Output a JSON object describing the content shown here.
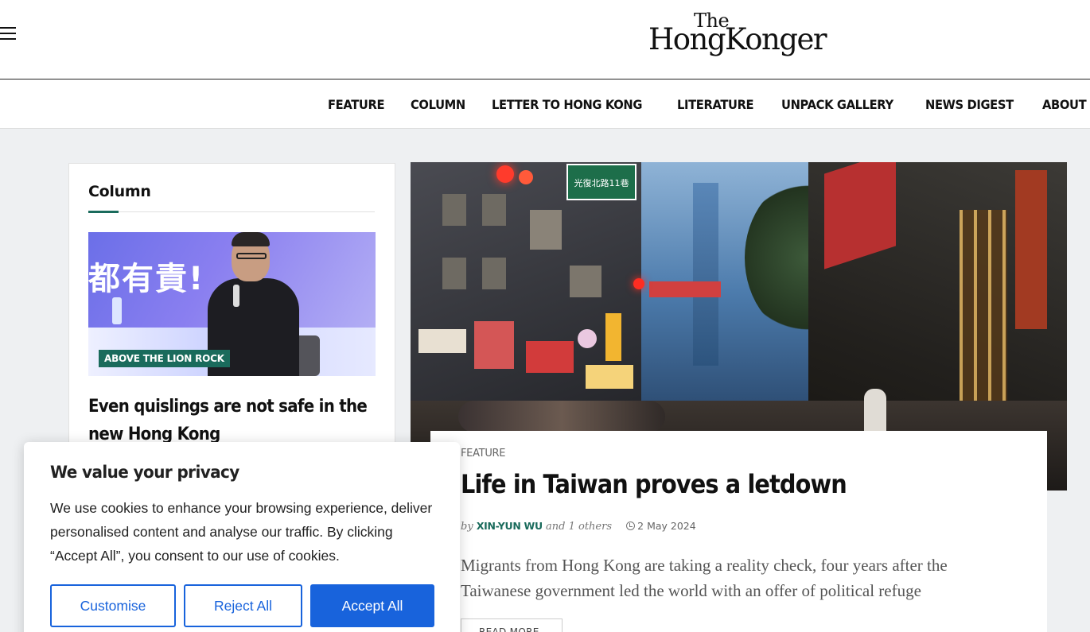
{
  "header": {
    "logo_the": "The",
    "logo_main": "HongKonger"
  },
  "nav": {
    "items": [
      "FEATURE",
      "COLUMN",
      "LETTER TO HONG KONG",
      "LITERATURE",
      "UNPACK GALLERY",
      "NEWS DIGEST",
      "ABOUT"
    ]
  },
  "sidebar": {
    "title": "Column",
    "banner_text": "都有責!",
    "badge": "ABOVE THE LION ROCK",
    "headline": "Even quislings are not safe in the new Hong Kong"
  },
  "feature": {
    "street_sign": "光復北路11巷",
    "category": "FEATURE",
    "title": "Life in Taiwan proves a letdown",
    "by": "by",
    "author": "XIN-YUN WU",
    "others": "and 1 others",
    "date": "2 May 2024",
    "excerpt": "Migrants from Hong Kong are taking a reality check, four years after the Taiwanese government led the world with an offer of political refuge",
    "read_more": "READ MORE"
  },
  "cookie": {
    "title": "We value your privacy",
    "body": "We use cookies to enhance your browsing experience, deliver personalised content and analyse our traffic. By clicking “Accept All”, you consent to our use of cookies.",
    "customise": "Customise",
    "reject": "Reject All",
    "accept": "Accept All"
  },
  "colors": {
    "accent_green": "#1a6b5c",
    "cookie_blue": "#1863dc"
  }
}
